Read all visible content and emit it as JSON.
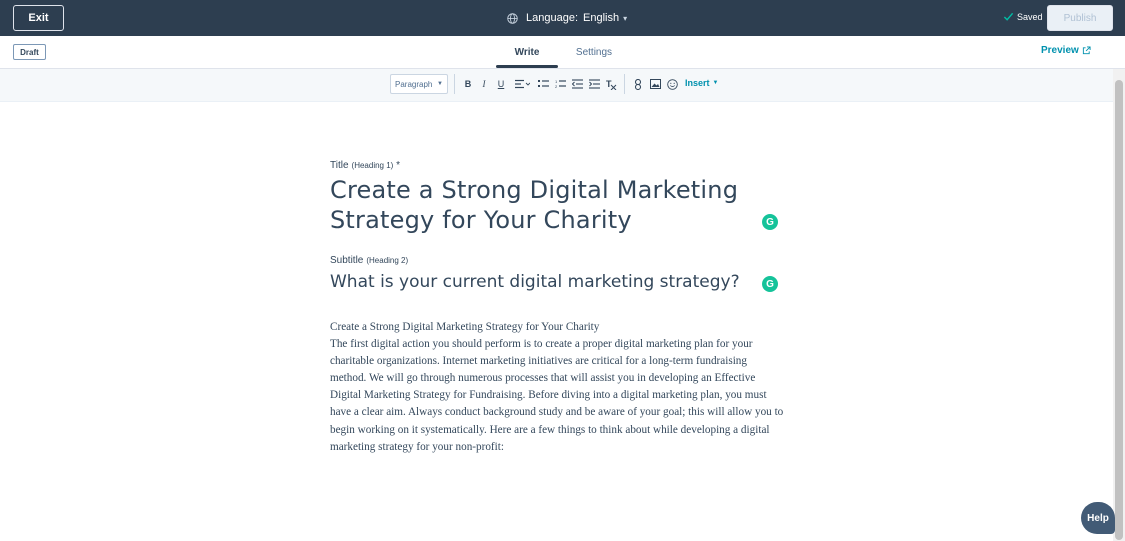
{
  "topbar": {
    "exit_label": "Exit",
    "language_label": "Language:",
    "language_value": "English",
    "saved_label": "Saved",
    "publish_label": "Publish"
  },
  "subbar": {
    "status_badge": "Draft",
    "tabs": [
      {
        "label": "Write",
        "active": true
      },
      {
        "label": "Settings",
        "active": false
      }
    ],
    "preview_label": "Preview"
  },
  "toolbar": {
    "paragraph_select": "Paragraph",
    "insert_label": "Insert",
    "icons": [
      "bold-icon",
      "italic-icon",
      "underline-icon",
      "align-icon",
      "bulleted-list-icon",
      "numbered-list-icon",
      "outdent-icon",
      "indent-icon",
      "clear-format-icon",
      "link-icon",
      "image-icon",
      "emoji-icon"
    ]
  },
  "editor": {
    "title_label": "Title",
    "title_sub": "(Heading 1)",
    "title_required": "*",
    "title_value": "Create a Strong Digital Marketing Strategy for Your Charity",
    "subtitle_label": "Subtitle",
    "subtitle_sub": "(Heading 2)",
    "subtitle_value": "What is your current digital marketing strategy?",
    "body_heading": "Create a Strong Digital Marketing Strategy for Your Charity",
    "body_paragraph": "The first digital action you should perform is to create a proper digital marketing plan for your charitable organizations. Internet marketing initiatives are critical for a long-term fundraising method. We will go through numerous processes that will assist you in developing an Effective Digital Marketing Strategy for Fundraising. Before diving into a digital marketing plan, you must have a clear aim. Always conduct background study and be aware of your goal; this will allow you to begin working on it systematically. Here are a few things to think about while developing a digital marketing strategy for your non-profit:"
  },
  "help_label": "Help",
  "colors": {
    "topbar": "#2d3e50",
    "accent": "#0091ae",
    "grammarly": "#15c39a",
    "text": "#33475b"
  }
}
